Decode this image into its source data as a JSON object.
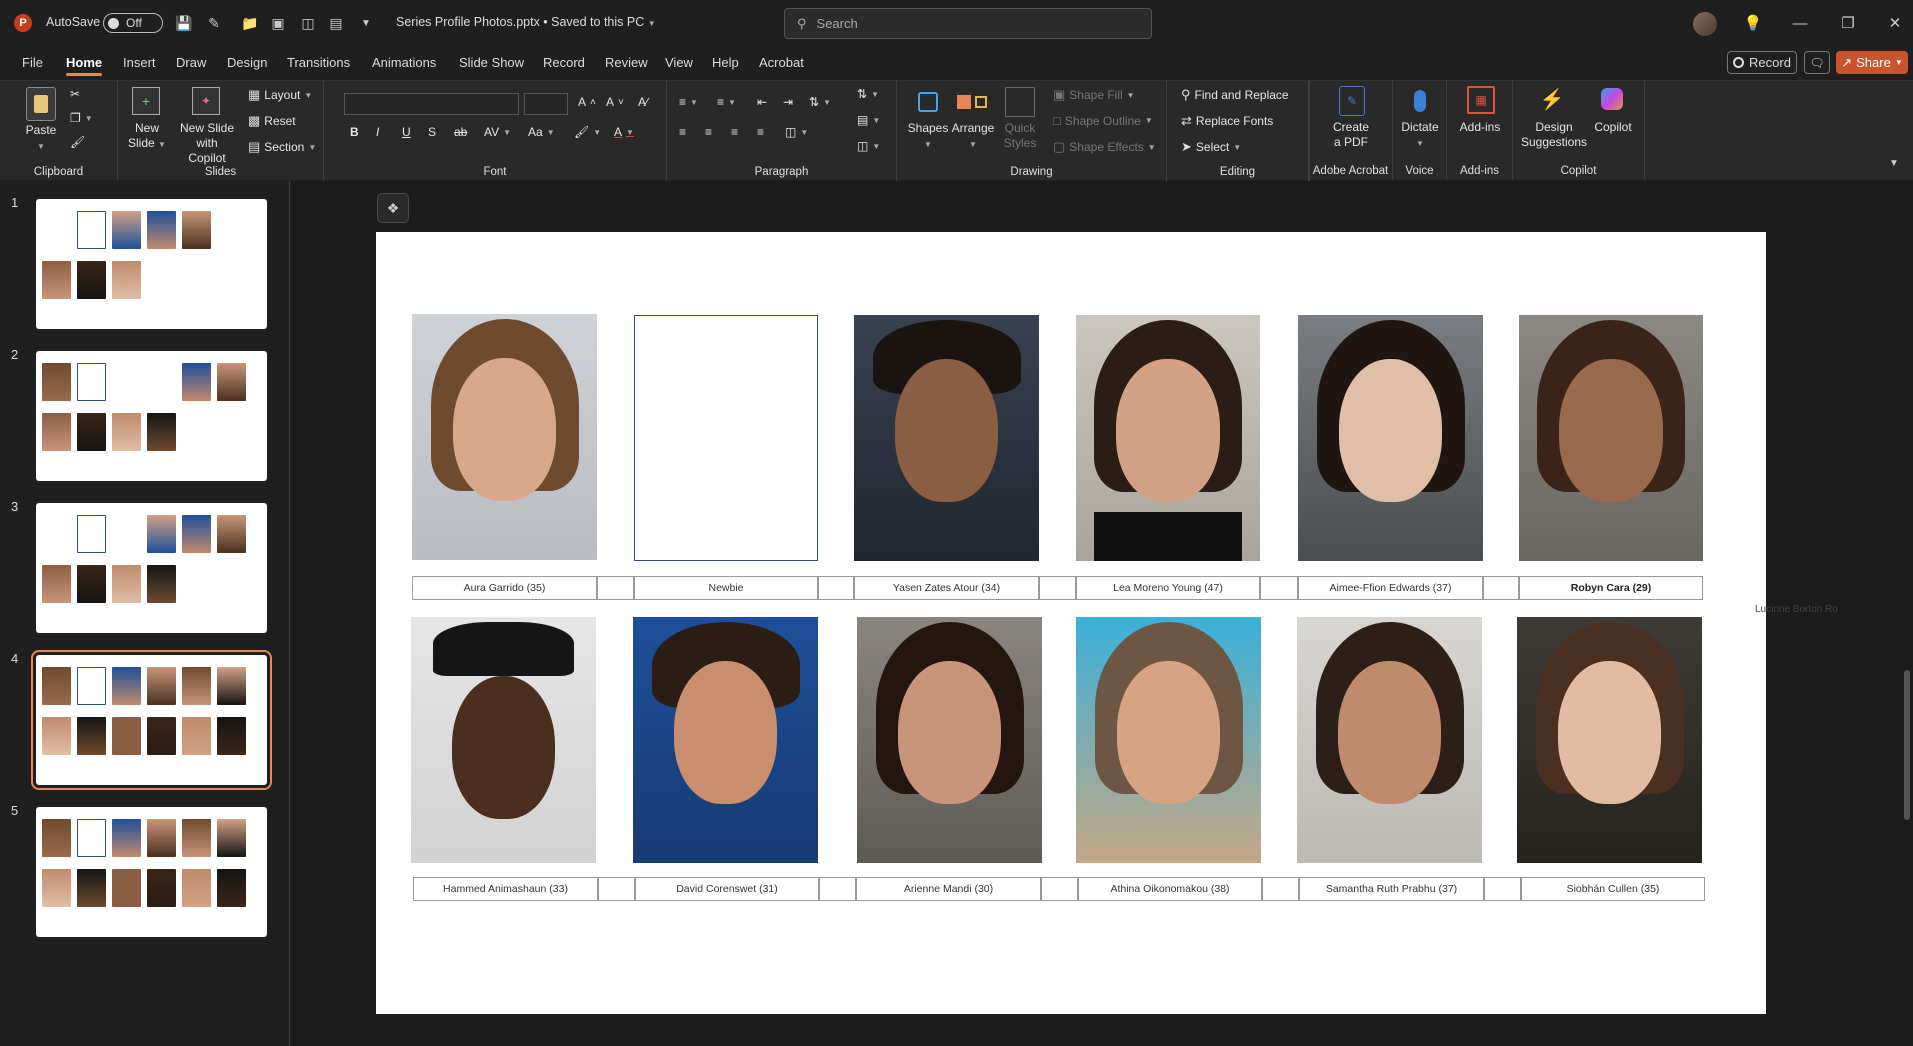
{
  "titlebar": {
    "autosave_label": "AutoSave",
    "autosave_state": "Off",
    "doc_title": "Series Profile Photos.pptx • Saved to this PC",
    "search_placeholder": "Search"
  },
  "menu": {
    "items": [
      "File",
      "Home",
      "Insert",
      "Draw",
      "Design",
      "Transitions",
      "Animations",
      "Slide Show",
      "Record",
      "Review",
      "View",
      "Help",
      "Acrobat"
    ],
    "active": "Home",
    "record_label": "Record",
    "share_label": "Share"
  },
  "ribbon": {
    "clipboard": {
      "paste": "Paste",
      "label": "Clipboard"
    },
    "slides": {
      "new_slide": "New",
      "new_slide2": "Slide",
      "new_copilot": "New Slide",
      "new_copilot2": "with Copilot",
      "layout": "Layout",
      "reset": "Reset",
      "section": "Section",
      "label": "Slides"
    },
    "font": {
      "label": "Font"
    },
    "paragraph": {
      "label": "Paragraph"
    },
    "drawing": {
      "shapes": "Shapes",
      "arrange": "Arrange",
      "quick_styles": "Quick",
      "quick_styles2": "Styles",
      "shape_fill": "Shape Fill",
      "shape_outline": "Shape Outline",
      "shape_effects": "Shape Effects",
      "label": "Drawing"
    },
    "editing": {
      "find_replace": "Find and Replace",
      "replace_fonts": "Replace Fonts",
      "select": "Select",
      "label": "Editing"
    },
    "acrobat": {
      "create_pdf": "Create",
      "create_pdf2": "a PDF",
      "label": "Adobe Acrobat"
    },
    "voice": {
      "dictate": "Dictate",
      "label": "Voice"
    },
    "addins": {
      "addins": "Add-ins",
      "label": "Add-ins"
    },
    "copilot": {
      "design": "Design",
      "design2": "Suggestions",
      "copilot": "Copilot",
      "label": "Copilot"
    }
  },
  "thumbnails": {
    "numbers": [
      "1",
      "2",
      "3",
      "4",
      "5"
    ],
    "selected": "4"
  },
  "slide": {
    "row1_names": [
      "Aura Garrido (35)",
      "Newbie",
      "Yasen Zates Atour (34)",
      "Lea Moreno Young (47)",
      "Aimee-Ffion Edwards (37)",
      "Robyn Cara (29)"
    ],
    "row2_names": [
      "Hammed Animashaun (33)",
      "David Corenswet (31)",
      "Arienne Mandi (30)",
      "Athina Oikonomakou (38)",
      "Samantha Ruth Prabhu (37)",
      "Siobhán Cullen (35)"
    ],
    "stray_text": "Lucinne Borton Ro"
  },
  "colors": {
    "accent": "#e8855a",
    "share": "#c8532c",
    "ribbon_bg": "#292929",
    "app_bg": "#1f1f1f"
  }
}
